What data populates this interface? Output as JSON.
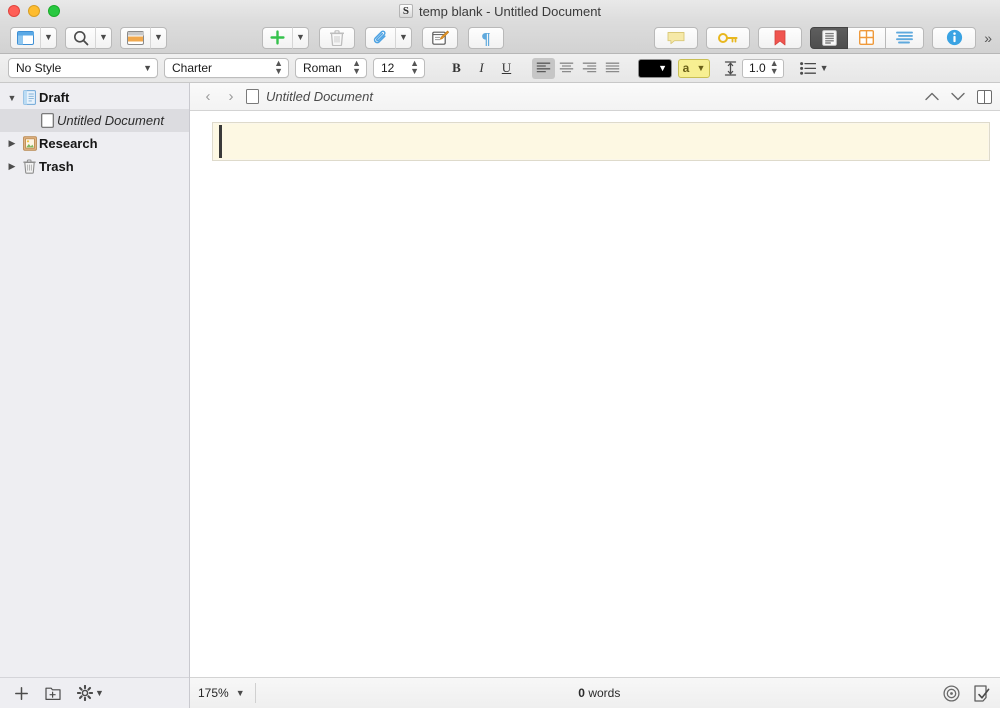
{
  "window": {
    "title": "temp blank - Untitled Document",
    "app_icon": "scrivener-icon",
    "traffic_lights": [
      "close",
      "minimize",
      "zoom"
    ]
  },
  "toolbar": {
    "left_group": [
      {
        "name": "binder-toggle",
        "icon": "sidebar-layout-icon",
        "has_menu": true
      },
      {
        "name": "search",
        "icon": "search-icon",
        "has_menu": true
      },
      {
        "name": "inspector-layout",
        "icon": "inspector-panel-icon",
        "has_menu": true
      }
    ],
    "center_group": [
      {
        "name": "add",
        "icon": "plus-icon",
        "has_menu": true,
        "enabled": true
      },
      {
        "name": "delete",
        "icon": "trash-icon",
        "has_menu": false,
        "enabled": false
      },
      {
        "name": "attach",
        "icon": "paperclip-icon",
        "has_menu": true,
        "enabled": true
      },
      {
        "name": "compose",
        "icon": "compose-note-icon",
        "has_menu": false,
        "enabled": true
      },
      {
        "name": "invisibles",
        "icon": "pilcrow-icon",
        "has_menu": false,
        "enabled": true
      }
    ],
    "right_group": [
      {
        "name": "comments",
        "icon": "comment-bubble-icon"
      },
      {
        "name": "keywords",
        "icon": "key-icon"
      },
      {
        "name": "bookmarks",
        "icon": "bookmark-icon"
      }
    ],
    "view_modes": [
      {
        "name": "document-view",
        "icon": "document-lines-icon",
        "selected": true
      },
      {
        "name": "corkboard-view",
        "icon": "corkboard-grid-icon",
        "selected": false
      },
      {
        "name": "outliner-view",
        "icon": "outliner-lines-icon",
        "selected": false
      }
    ],
    "inspector": {
      "name": "inspector",
      "icon": "info-circle-icon"
    },
    "overflow_label": "»"
  },
  "format_bar": {
    "style": {
      "label": "No Style",
      "options": [
        "No Style"
      ]
    },
    "font": {
      "label": "Charter",
      "options": [
        "Charter"
      ]
    },
    "typeface": {
      "label": "Roman",
      "options": [
        "Roman"
      ]
    },
    "size": {
      "label": "12",
      "options": [
        "12"
      ]
    },
    "bold_label": "B",
    "italic_label": "I",
    "underline_label": "U",
    "align": [
      {
        "name": "align-left",
        "selected": true
      },
      {
        "name": "align-center",
        "selected": false
      },
      {
        "name": "align-right",
        "selected": false
      },
      {
        "name": "align-justify",
        "selected": false
      }
    ],
    "text_color": "#000000",
    "highlight_color": "#f7ef92",
    "highlight_label": "a",
    "line_spacing": {
      "label": "1.0",
      "icon": "line-height-icon"
    },
    "list": {
      "icon": "bullet-list-icon"
    }
  },
  "sidebar": {
    "items": [
      {
        "label": "Draft",
        "icon": "manuscript-icon",
        "expanded": true,
        "level": 0,
        "selected": false,
        "bold": true
      },
      {
        "label": "Untitled Document",
        "icon": "blank-document-icon",
        "expanded": null,
        "level": 1,
        "selected": true,
        "bold": false
      },
      {
        "label": "Research",
        "icon": "research-folder-icon",
        "expanded": false,
        "level": 0,
        "selected": false,
        "bold": true
      },
      {
        "label": "Trash",
        "icon": "trash-icon",
        "expanded": false,
        "level": 0,
        "selected": false,
        "bold": true
      }
    ],
    "footer": [
      {
        "name": "add-item",
        "icon": "plus-icon"
      },
      {
        "name": "add-folder",
        "icon": "new-folder-icon"
      },
      {
        "name": "binder-settings",
        "icon": "gear-icon",
        "has_menu": true
      }
    ]
  },
  "editor": {
    "back_icon": "chevron-left-icon",
    "forward_icon": "chevron-right-icon",
    "doc_icon": "blank-document-icon",
    "title": "Untitled Document",
    "prev_icon": "chevron-up-icon",
    "next_icon": "chevron-down-icon",
    "split_icon": "split-view-icon",
    "content": {
      "text": "",
      "highlight_color": "#fdf8e3",
      "caret_visible": true
    }
  },
  "status_bar": {
    "zoom": {
      "label": "175%",
      "options": [
        "175%"
      ]
    },
    "word_count_value": "0",
    "word_count_label": " words",
    "right_icons": [
      {
        "name": "writing-goals",
        "icon": "target-icon"
      },
      {
        "name": "document-complete",
        "icon": "check-document-icon"
      }
    ]
  }
}
